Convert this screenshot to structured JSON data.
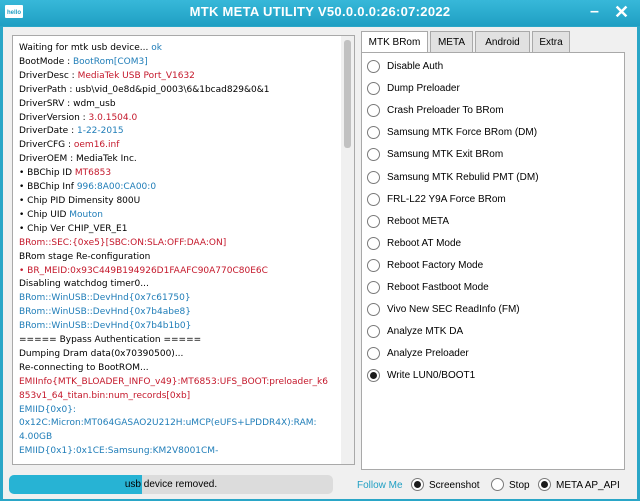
{
  "window": {
    "title": "MTK META UTILITY V50.0.0.0:26:07:2022",
    "icon_text": "hello",
    "minimize_icon": "minimize-icon",
    "close_icon": "close-icon"
  },
  "log": [
    [
      {
        "t": "Waiting for mtk usb device... ",
        "c": "black"
      },
      {
        "t": "ok",
        "c": "blue"
      }
    ],
    [
      {
        "t": "BootMode : ",
        "c": "black"
      },
      {
        "t": "BootRom[COM3]",
        "c": "blue"
      }
    ],
    [
      {
        "t": "DriverDesc : ",
        "c": "black"
      },
      {
        "t": "MediaTek USB Port_V1632",
        "c": "red"
      }
    ],
    [
      {
        "t": "DriverPath : usb\\vid_0e8d&pid_0003\\6&1bcad829&0&1",
        "c": "black"
      }
    ],
    [
      {
        "t": "DriverSRV : wdm_usb",
        "c": "black"
      }
    ],
    [
      {
        "t": "DriverVersion : ",
        "c": "black"
      },
      {
        "t": "3.0.1504.0",
        "c": "red"
      }
    ],
    [
      {
        "t": "DriverDate : ",
        "c": "black"
      },
      {
        "t": "1-22-2015",
        "c": "blue"
      }
    ],
    [
      {
        "t": "DriverCFG : ",
        "c": "black"
      },
      {
        "t": "oem16.inf",
        "c": "red"
      }
    ],
    [
      {
        "t": "DriverOEM : MediaTek Inc.",
        "c": "black"
      }
    ],
    [
      {
        "t": "• ",
        "c": "black"
      },
      {
        "t": "BBChip ID ",
        "c": "black"
      },
      {
        "t": "MT6853",
        "c": "red"
      }
    ],
    [
      {
        "t": "• ",
        "c": "black"
      },
      {
        "t": "BBChip Inf ",
        "c": "black"
      },
      {
        "t": "996:8A00:CA00:0",
        "c": "blue"
      }
    ],
    [
      {
        "t": "• ",
        "c": "black"
      },
      {
        "t": "Chip PID Dimensity 800U",
        "c": "black"
      }
    ],
    [
      {
        "t": "• ",
        "c": "black"
      },
      {
        "t": "Chip UID ",
        "c": "black"
      },
      {
        "t": "Mouton",
        "c": "blue"
      }
    ],
    [
      {
        "t": "• ",
        "c": "black"
      },
      {
        "t": "Chip Ver CHIP_VER_E1",
        "c": "black"
      }
    ],
    [
      {
        "t": "BRom::SEC:{0xe5}[SBC:ON:SLA:OFF:DAA:ON]",
        "c": "red"
      }
    ],
    [
      {
        "t": "BRom stage Re-configuration",
        "c": "black"
      }
    ],
    [
      {
        "t": "• ",
        "c": "red"
      },
      {
        "t": "BR_MEID:0x93C449B194926D1FAAFC90A770C80E6C",
        "c": "red"
      }
    ],
    [
      {
        "t": "Disabling watchdog timer0...",
        "c": "black"
      }
    ],
    [
      {
        "t": "BRom::WinUSB::DevHnd{0x7c61750}",
        "c": "blue"
      }
    ],
    [
      {
        "t": "BRom::WinUSB::DevHnd{0x7b4abe8}",
        "c": "blue"
      }
    ],
    [
      {
        "t": "BRom::WinUSB::DevHnd{0x7b4b1b0}",
        "c": "blue"
      }
    ],
    [
      {
        "t": "===== Bypass Authentication =====",
        "c": "black"
      }
    ],
    [
      {
        "t": "Dumping Dram data(0x70390500)...",
        "c": "black"
      }
    ],
    [
      {
        "t": "Re-connecting to BootROM...",
        "c": "black"
      }
    ],
    [
      {
        "t": "EMIInfo{MTK_BLOADER_INFO_v49}:MT6853:UFS_BOOT:preloader_k6",
        "c": "red"
      }
    ],
    [
      {
        "t": "853v1_64_titan.bin:num_records[0xb]",
        "c": "red"
      }
    ],
    [
      {
        "t": "EMIID{0x0}:",
        "c": "blue"
      }
    ],
    [
      {
        "t": "0x12C:Micron:MT064GASAO2U212H:uMCP(eUFS+LPDDR4X):RAM:",
        "c": "blue"
      }
    ],
    [
      {
        "t": "4.00GB",
        "c": "blue"
      }
    ],
    [
      {
        "t": "EMIID{0x1}:0x1CE:Samsung:KM2V8001CM-",
        "c": "blue"
      }
    ]
  ],
  "progress": {
    "label": "usb device removed.",
    "value": 0.41
  },
  "tabs": [
    {
      "label": "MTK BRom",
      "active": true
    },
    {
      "label": "META",
      "active": false
    },
    {
      "label": "Android",
      "active": false
    },
    {
      "label": "Extra",
      "active": false
    }
  ],
  "options": [
    {
      "label": "Disable Auth",
      "checked": false
    },
    {
      "label": "Dump Preloader",
      "checked": false
    },
    {
      "label": "Crash Preloader To BRom",
      "checked": false
    },
    {
      "label": "Samsung MTK Force BRom (DM)",
      "checked": false
    },
    {
      "label": "Samsung MTK Exit BRom",
      "checked": false
    },
    {
      "label": "Samsung MTK Rebulid PMT (DM)",
      "checked": false
    },
    {
      "label": "FRL-L22 Y9A Force BRom",
      "checked": false
    },
    {
      "label": "Reboot META",
      "checked": false
    },
    {
      "label": "Reboot AT Mode",
      "checked": false
    },
    {
      "label": "Reboot Factory Mode",
      "checked": false
    },
    {
      "label": "Reboot Fastboot Mode",
      "checked": false
    },
    {
      "label": "Vivo New SEC ReadInfo (FM)",
      "checked": false
    },
    {
      "label": "Analyze MTK DA",
      "checked": false
    },
    {
      "label": "Analyze Preloader",
      "checked": false
    },
    {
      "label": "Write LUN0/BOOT1",
      "checked": true
    }
  ],
  "footer": {
    "follow_label": "Follow Me",
    "screenshot_label": "Screenshot",
    "screenshot_checked": true,
    "stop_label": "Stop",
    "stop_checked": false,
    "meta_label": "META AP_API",
    "meta_checked": true
  },
  "colors": {
    "accent": "#1f9fc3",
    "log_red": "#c4182b",
    "log_blue": "#1f7db8",
    "progress": "#27b3d4"
  }
}
